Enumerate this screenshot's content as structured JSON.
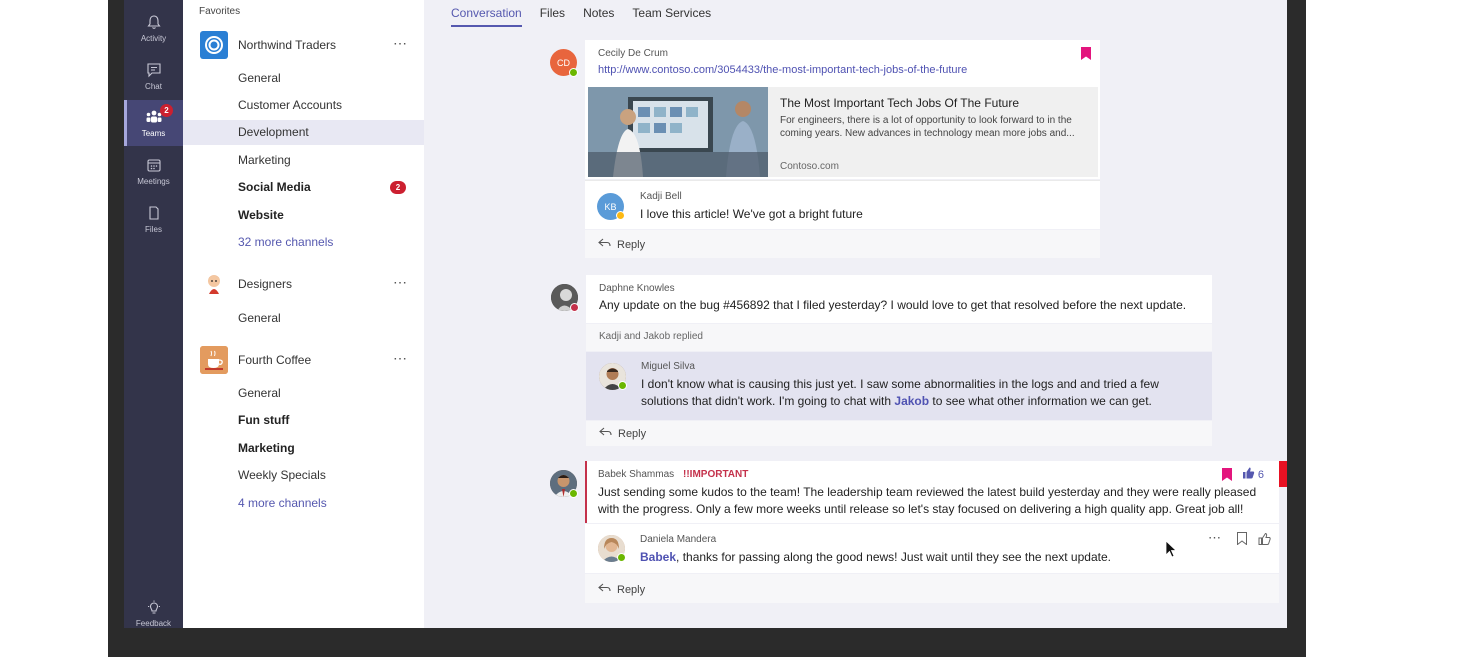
{
  "rail": {
    "items": [
      {
        "label": "Activity",
        "icon": "bell-icon"
      },
      {
        "label": "Chat",
        "icon": "chat-icon"
      },
      {
        "label": "Teams",
        "icon": "teams-icon",
        "badge": "2"
      },
      {
        "label": "Meetings",
        "icon": "calendar-icon"
      },
      {
        "label": "Files",
        "icon": "file-icon"
      }
    ],
    "feedback": "Feedback"
  },
  "teams_panel": {
    "favorites": "Favorites",
    "teams": [
      {
        "name": "Northwind Traders",
        "more": "⋯",
        "channels": [
          {
            "label": "General"
          },
          {
            "label": "Customer Accounts"
          },
          {
            "label": "Development"
          },
          {
            "label": "Marketing"
          },
          {
            "label": "Social Media",
            "badge": "2"
          },
          {
            "label": "Website"
          },
          {
            "label": "32 more channels"
          }
        ]
      },
      {
        "name": "Designers",
        "more": "⋯",
        "channels": [
          {
            "label": "General"
          }
        ]
      },
      {
        "name": "Fourth Coffee",
        "more": "⋯",
        "channels": [
          {
            "label": "General"
          },
          {
            "label": "Fun stuff"
          },
          {
            "label": "Marketing"
          },
          {
            "label": "Weekly Specials"
          },
          {
            "label": "4 more channels"
          }
        ]
      }
    ]
  },
  "tabs": [
    "Conversation",
    "Files",
    "Notes",
    "Team Services"
  ],
  "messages": {
    "m1": {
      "author": "Cecily De Crum",
      "initials": "CD",
      "link": "http://www.contoso.com/3054433/the-most-important-tech-jobs-of-the-future",
      "preview_title": "The Most Important Tech Jobs Of The Future",
      "preview_desc": "For engineers, there is a lot of opportunity to look forward to in the coming years. New advances in technology mean more jobs and...",
      "preview_source": "Contoso.com",
      "reply_author": "Kadji Bell",
      "reply_initials": "KB",
      "reply_text": "I love this article! We've got a bright future",
      "reply_label": "Reply"
    },
    "m2": {
      "author": "Daphne Knowles",
      "text": "Any update on the bug #456892 that I filed yesterday? I would love to get that resolved before the next update.",
      "replied_note": "Kadji and Jakob replied",
      "reply_author": "Miguel Silva",
      "reply_text_1": "I don't know what is causing this just yet. I saw some abnormalities in the logs and and tried a few solutions that didn't work. I'm going to chat with ",
      "reply_mention": "Jakob",
      "reply_text_2": " to see what other information we can get.",
      "reply_label": "Reply"
    },
    "m3": {
      "author": "Babek Shammas",
      "important": "!!IMPORTANT",
      "text": "Just sending some kudos to the team! The leadership team reviewed the latest build yesterday and they were really pleased with the progress. Only a few more weeks until release so let's stay focused on delivering a high quality app. Great job all!",
      "likes": "6",
      "reply_author": "Daniela Mandera",
      "reply_mention": "Babek",
      "reply_text": ", thanks for passing along the good news! Just wait until they see the next update.",
      "reply_label": "Reply"
    }
  },
  "colors": {
    "rail": "#33344a",
    "accent": "#5558af",
    "badge": "#cc2030",
    "important": "#c4314b"
  }
}
